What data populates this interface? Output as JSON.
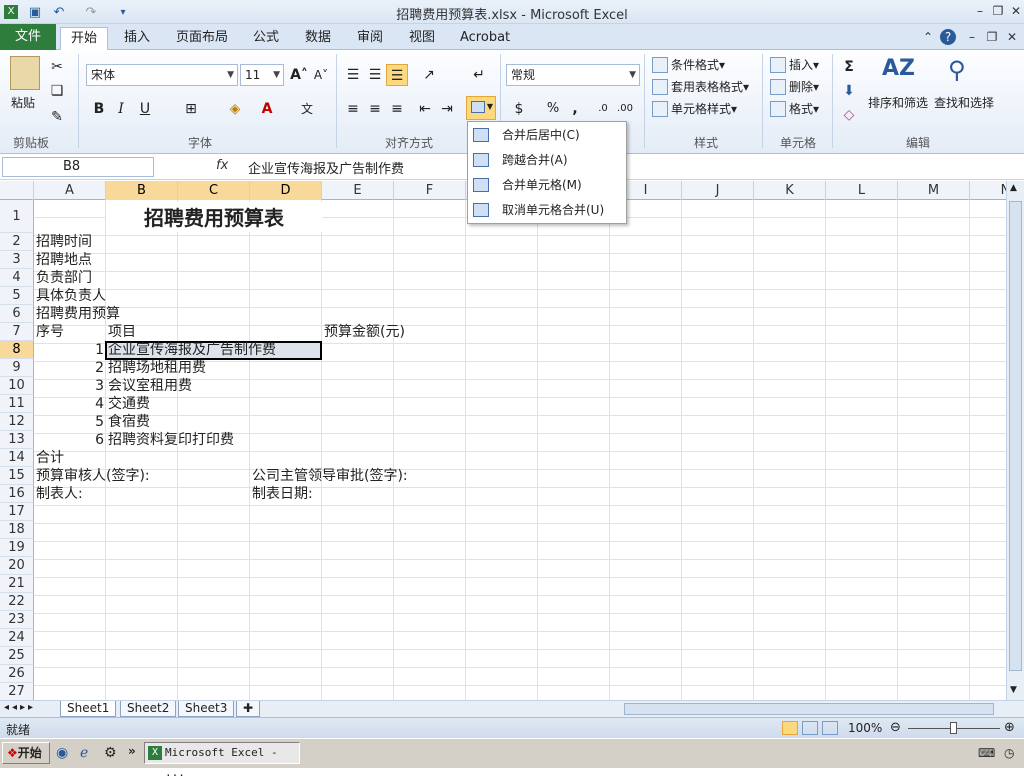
{
  "window": {
    "title": "招聘费用预算表.xlsx - Microsoft Excel"
  },
  "tabs": [
    "文件",
    "开始",
    "插入",
    "页面布局",
    "公式",
    "数据",
    "审阅",
    "视图",
    "Acrobat"
  ],
  "ribbon": {
    "clipboard": {
      "paste": "粘贴",
      "group": "剪贴板"
    },
    "font": {
      "name": "宋体",
      "size": "11",
      "bold": "B",
      "italic": "I",
      "underline": "U",
      "group": "字体"
    },
    "alignment": {
      "group": "对齐方式"
    },
    "number": {
      "format": "常规",
      "percent": "%",
      "comma": ",",
      "inc": "+.0\n.00",
      "dec": ".00\n→.0"
    },
    "styles": {
      "conditional": "条件格式",
      "table": "套用表格格式",
      "cell": "单元格样式",
      "group": "样式"
    },
    "cells": {
      "insert": "插入",
      "delete": "删除",
      "format": "格式",
      "group": "单元格"
    },
    "editing": {
      "sigma": "Σ",
      "sort": "排序和筛选",
      "find": "查找和选择",
      "group": "编辑"
    }
  },
  "formula_bar": {
    "name_box": "B8",
    "fx": "fx",
    "value": "企业宣传海报及广告制作费"
  },
  "columns": [
    "A",
    "B",
    "C",
    "D",
    "E",
    "F",
    "G",
    "H",
    "I",
    "J",
    "K",
    "L",
    "M",
    "N"
  ],
  "rows": [
    "1",
    "2",
    "3",
    "4",
    "5",
    "6",
    "7",
    "8",
    "9",
    "10",
    "11",
    "12",
    "13",
    "14",
    "15",
    "16",
    "17",
    "18",
    "19",
    "20",
    "21",
    "22",
    "23",
    "24",
    "25",
    "26",
    "27"
  ],
  "sheet": {
    "title": "招聘费用预算表",
    "r2": "招聘时间",
    "r3": "招聘地点",
    "r4": "负责部门",
    "r5": "具体负责人",
    "r6": "招聘费用预算",
    "h_no": "序号",
    "h_item": "项目",
    "h_amount": "预算金额(元)",
    "items": [
      {
        "no": "1",
        "name": "企业宣传海报及广告制作费"
      },
      {
        "no": "2",
        "name": "招聘场地租用费"
      },
      {
        "no": "3",
        "name": "会议室租用费"
      },
      {
        "no": "4",
        "name": "交通费"
      },
      {
        "no": "5",
        "name": "食宿费"
      },
      {
        "no": "6",
        "name": "招聘资料复印打印费"
      }
    ],
    "total": "合计",
    "reviewer": "预算审核人(签字):",
    "approver": "公司主管领导审批(签字):",
    "maker": "制表人:",
    "date": "制表日期:"
  },
  "merge_menu": {
    "items": [
      "合并后居中(C)",
      "跨越合并(A)",
      "合并单元格(M)",
      "取消单元格合并(U)"
    ]
  },
  "sheet_tabs": [
    "Sheet1",
    "Sheet2",
    "Sheet3"
  ],
  "status": {
    "ready": "就绪",
    "zoom": "100%"
  },
  "taskbar": {
    "start": "开始",
    "task": "Microsoft Excel - ..."
  }
}
